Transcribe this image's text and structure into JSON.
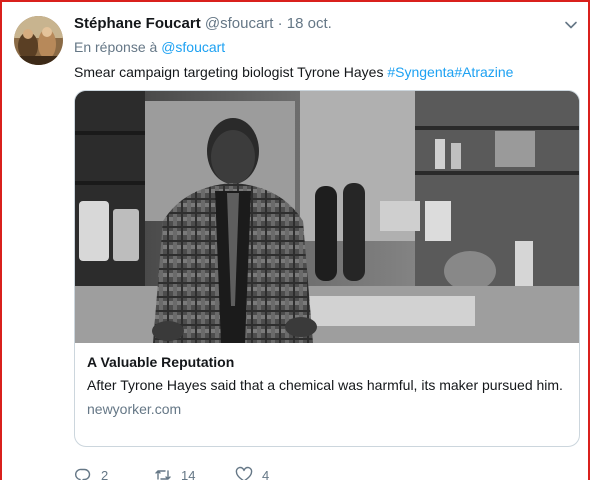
{
  "tweet": {
    "author_name": "Stéphane Foucart",
    "author_handle": "@sfoucart",
    "separator": "·",
    "date": "18 oct.",
    "reply_prefix": "En réponse à",
    "reply_to": "@sfoucart",
    "text": "Smear campaign targeting biologist Tyrone Hayes",
    "hashtags": [
      "#Syngenta",
      "#Atrazine"
    ]
  },
  "card": {
    "title": "A Valuable Reputation",
    "description": "After Tyrone Hayes said that a chemical was harmful, its maker pursued him.",
    "domain": "newyorker.com"
  },
  "actions": {
    "reply_count": "2",
    "retweet_count": "14",
    "like_count": "4"
  },
  "colors": {
    "accent": "#1da1f2",
    "secondary_text": "#657786",
    "border": "#ccd6dd",
    "frame": "#d9201c"
  },
  "icons": [
    "chevron-down-icon",
    "reply-icon",
    "retweet-icon",
    "like-icon"
  ]
}
